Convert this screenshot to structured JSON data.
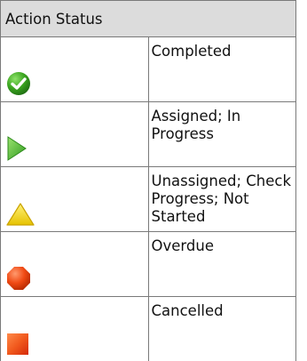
{
  "header": {
    "title": "Action Status"
  },
  "rows": [
    {
      "label": "Completed",
      "icon": "completed-check-icon",
      "color": "#3aa41f"
    },
    {
      "label": "Assigned; In Progress",
      "icon": "in-progress-play-icon",
      "color": "#55c23a"
    },
    {
      "label": "Unassigned; Check Progress; Not Started",
      "icon": "warning-triangle-icon",
      "color": "#f1d40e"
    },
    {
      "label": "Overdue",
      "icon": "overdue-octagon-icon",
      "color": "#f04a14"
    },
    {
      "label": "Cancelled",
      "icon": "cancelled-square-icon",
      "color": "#f15a1e"
    }
  ]
}
